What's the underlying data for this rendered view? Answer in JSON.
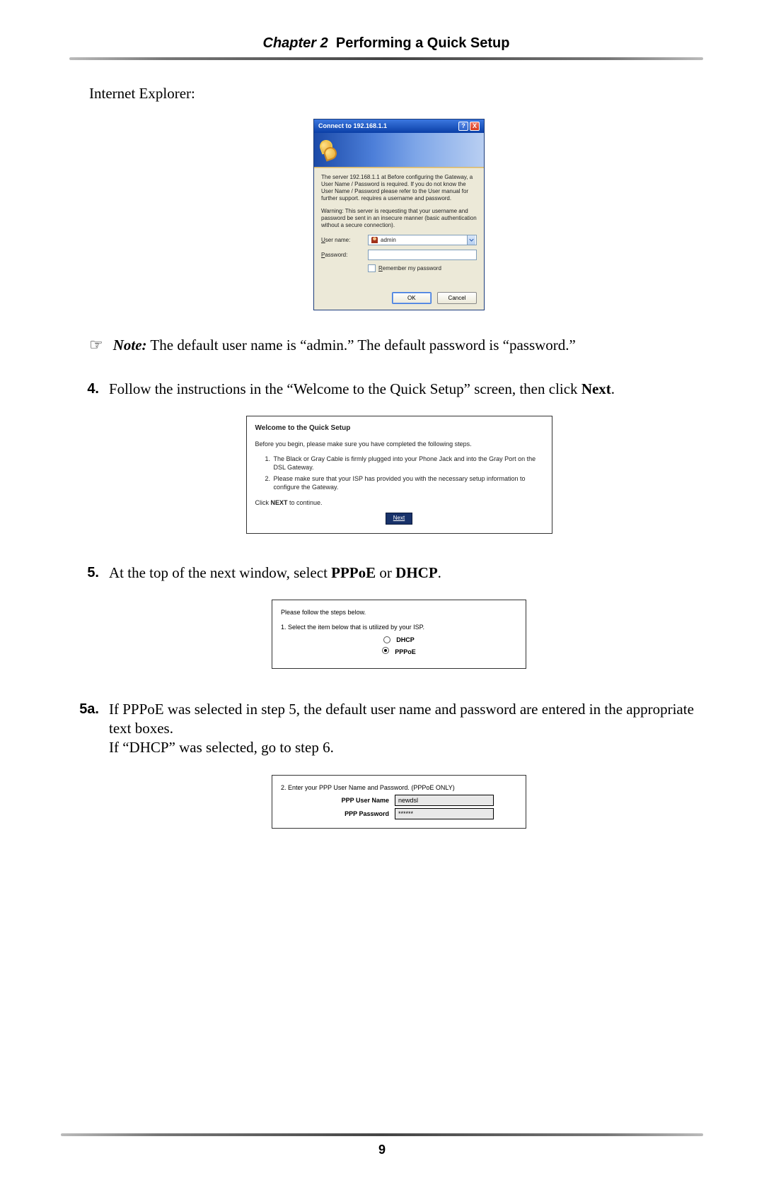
{
  "header": {
    "chapter": "Chapter 2",
    "title": "Performing a Quick Setup"
  },
  "page_number": "9",
  "ie_label": "Internet Explorer:",
  "auth": {
    "title": "Connect to 192.168.1.1",
    "help": "?",
    "close": "X",
    "msg1": "The server 192.168.1.1 at Before configuring the Gateway, a User Name / Password is required. If you do not know the User Name / Password please refer to the User manual for further support. requires a username and password.",
    "msg2": "Warning: This server is requesting that your username and password be sent in an insecure manner (basic authentication without a secure connection).",
    "user_label_pre": "U",
    "user_label_rest": "ser name:",
    "pass_label_pre": "P",
    "pass_label_rest": "assword:",
    "user_value": "admin",
    "remember_pre": "R",
    "remember_rest": "emember my password",
    "ok": "OK",
    "cancel": "Cancel"
  },
  "note": {
    "icon": "☞",
    "label": "Note:",
    "text": " The default user name is “admin.” The default password is “password.”"
  },
  "step4": {
    "num": "4.",
    "text_a": "Follow the instructions in the “Welcome to the Quick Setup” screen, then click ",
    "text_b": "Next",
    "text_c": "."
  },
  "welcome": {
    "title": "Welcome to the Quick Setup",
    "intro": "Before you begin, please make sure you have completed the following steps.",
    "li1": "The Black or Gray Cable is firmly plugged into your Phone Jack and into the Gray Port on the DSL Gateway.",
    "li2": "Please make sure that your ISP has provided you with the necessary setup information to configure the Gateway.",
    "click_a": "Click ",
    "click_b": "NEXT",
    "click_c": " to continue.",
    "next": "Next"
  },
  "step5": {
    "num": "5.",
    "text_a": "At the top of the next window, select ",
    "pppoe": "PPPoE",
    "or": " or ",
    "dhcp": "DHCP",
    "text_c": "."
  },
  "stepbox": {
    "lead": "Please follow the steps below.",
    "sel": "1. Select the item below that is utilized by your ISP.",
    "dhcp": "DHCP",
    "pppoe": "PPPoE"
  },
  "step5a": {
    "num": "5a.",
    "line1": "If PPPoE was selected in step 5,  the default user name and password are entered in the appropriate text boxes.",
    "line2": "If “DHCP” was selected, go to step 6."
  },
  "ppp": {
    "heading": "2. Enter your PPP User Name and Password. (PPPoE ONLY)",
    "user_label": "PPP User Name",
    "user_value": "newdsl",
    "pass_label": "PPP Password",
    "pass_value": "******"
  }
}
